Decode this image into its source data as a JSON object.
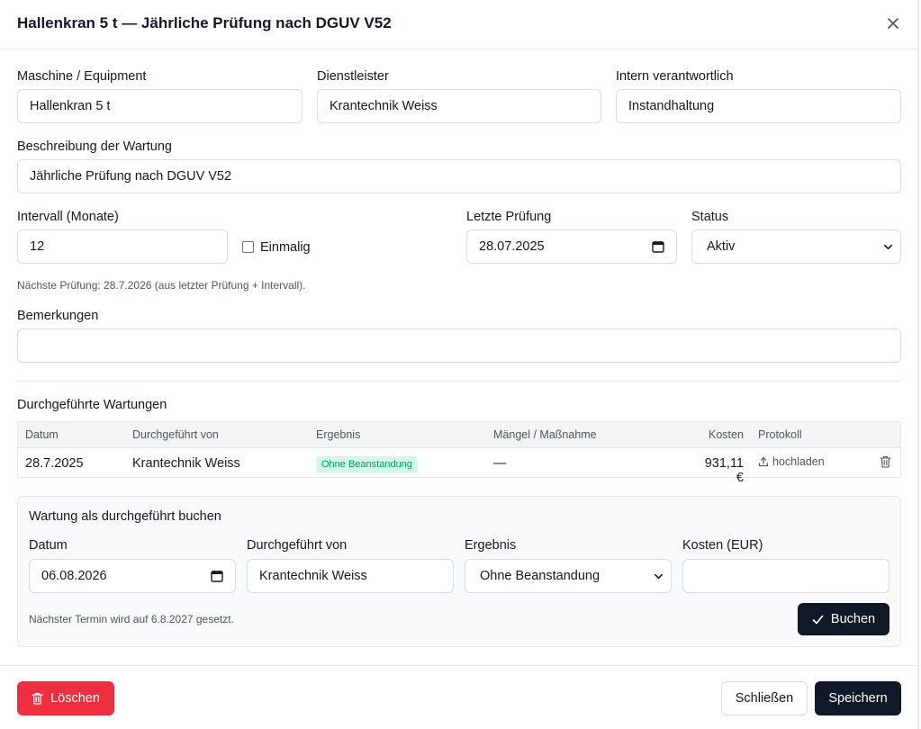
{
  "header": {
    "title": "Hallenkran 5 t — Jährliche Prüfung nach DGUV V52",
    "close_icon": "close-icon"
  },
  "form": {
    "machine": {
      "label": "Maschine / Equipment",
      "value": "Hallenkran 5 t"
    },
    "provider": {
      "label": "Dienstleister",
      "value": "Krantechnik Weiss"
    },
    "responsible": {
      "label": "Intern verantwortlich",
      "value": "Instandhaltung"
    },
    "description": {
      "label": "Beschreibung der Wartung",
      "value": "Jährliche Prüfung nach DGUV V52"
    },
    "interval": {
      "label": "Intervall (Monate)",
      "value": "12"
    },
    "once": {
      "label": "Einmalig",
      "checked": false
    },
    "last_check": {
      "label": "Letzte Prüfung",
      "value": "28.07.2025"
    },
    "status": {
      "label": "Status",
      "value": "Aktiv"
    },
    "next_check_hint": "Nächste Prüfung: 28.7.2026 (aus letzter Prüfung + Intervall).",
    "remarks": {
      "label": "Bemerkungen",
      "value": ""
    }
  },
  "history": {
    "title": "Durchgeführte Wartungen",
    "columns": [
      "Datum",
      "Durchgeführt von",
      "Ergebnis",
      "Mängel / Maßnahme",
      "Kosten",
      "Protokoll"
    ],
    "rows": [
      {
        "date": "28.7.2025",
        "by": "Krantechnik Weiss",
        "result": "Ohne Beanstandung",
        "defects": "—",
        "cost": "931,11 €",
        "protocol": "hochladen"
      }
    ]
  },
  "booking": {
    "title": "Wartung als durchgeführt buchen",
    "date": {
      "label": "Datum",
      "value": "06.08.2026"
    },
    "by": {
      "label": "Durchgeführt von",
      "value": "Krantechnik Weiss"
    },
    "result": {
      "label": "Ergebnis",
      "value": "Ohne Beanstandung"
    },
    "cost": {
      "label": "Kosten (EUR)",
      "value": ""
    },
    "hint": "Nächster Termin wird auf 6.8.2027 gesetzt.",
    "submit": "Buchen"
  },
  "footer": {
    "delete": "Löschen",
    "close": "Schließen",
    "save": "Speichern"
  },
  "colors": {
    "danger": "#ef2f3f",
    "dark": "#111827",
    "success_bg": "#d1fae5",
    "success_text": "#059669"
  }
}
